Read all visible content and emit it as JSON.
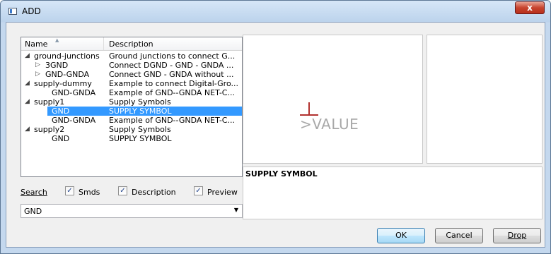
{
  "window": {
    "title": "ADD",
    "close_label": "x"
  },
  "tree": {
    "columns": {
      "name": "Name",
      "description": "Description"
    },
    "rows": [
      {
        "expander": "◢",
        "name": "ground-junctions",
        "description": "Ground junctions to connect G..."
      },
      {
        "expander": "▷",
        "name": "3GND",
        "description": "Connect DGND - GND - GNDA ..."
      },
      {
        "expander": "▷",
        "name": "GND-GNDA",
        "description": "Connect GND - GNDA without ..."
      },
      {
        "expander": "◢",
        "name": "supply-dummy",
        "description": "Example to connect Digital-Gro..."
      },
      {
        "expander": "",
        "name": "GND-GNDA",
        "description": "Example of GND--GNDA NET-C..."
      },
      {
        "expander": "◢",
        "name": "supply1",
        "description": "Supply Symbols"
      },
      {
        "expander": "",
        "name": "GND",
        "description": "SUPPLY SYMBOL",
        "selected": true
      },
      {
        "expander": "",
        "name": "GND-GNDA",
        "description": "Example of GND--GNDA NET-C..."
      },
      {
        "expander": "◢",
        "name": "supply2",
        "description": "Supply Symbols"
      },
      {
        "expander": "",
        "name": "GND",
        "description": "SUPPLY SYMBOL"
      }
    ]
  },
  "search": {
    "label": "Search",
    "smds_label": "Smds",
    "description_label": "Description",
    "preview_label": "Preview",
    "smds_checked": true,
    "description_checked": true,
    "preview_checked": true,
    "value": "GND",
    "check_glyph": "✓",
    "arrow_glyph": "▼"
  },
  "preview": {
    "symbol_text": ">VALUE",
    "symbol_color": "#b2322f"
  },
  "description_panel": {
    "text": "SUPPLY SYMBOL"
  },
  "buttons": {
    "ok": "OK",
    "cancel": "Cancel",
    "drop": "Drop"
  },
  "colors": {
    "selection": "#3399ff",
    "title_bar": "#bcd3ec"
  }
}
